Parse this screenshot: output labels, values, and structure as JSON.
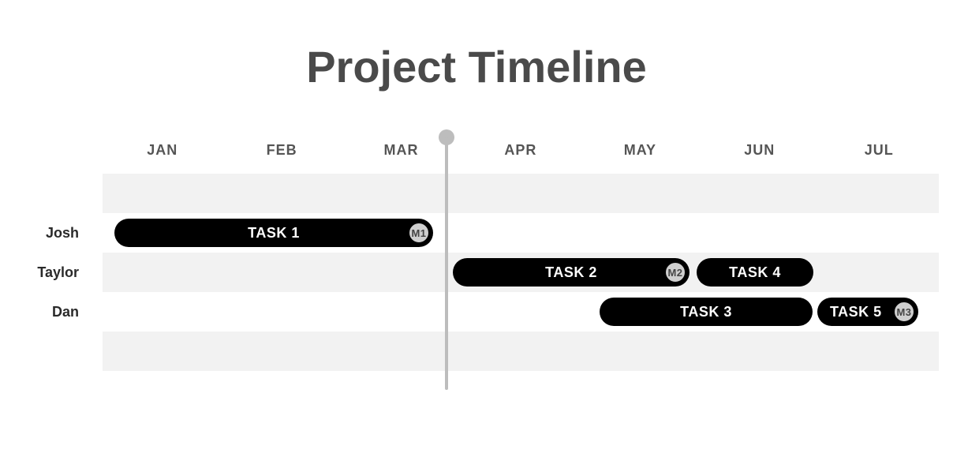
{
  "title": "Project Timeline",
  "months": [
    "JAN",
    "FEB",
    "MAR",
    "APR",
    "MAY",
    "JUN",
    "JUL"
  ],
  "people": [
    "Josh",
    "Taylor",
    "Dan"
  ],
  "tasks": {
    "t1": {
      "label": "TASK 1"
    },
    "t2": {
      "label": "TASK 2"
    },
    "t3": {
      "label": "TASK 3"
    },
    "t4": {
      "label": "TASK 4"
    },
    "t5": {
      "label": "TASK 5"
    }
  },
  "milestones": {
    "m1": "M1",
    "m2": "M2",
    "m3": "M3"
  },
  "chart_data": {
    "type": "gantt",
    "title": "Project Timeline",
    "x_categories": [
      "JAN",
      "FEB",
      "MAR",
      "APR",
      "MAY",
      "JUN",
      "JUL"
    ],
    "today_marker_after": "MAR",
    "rows": [
      {
        "label": "Josh",
        "tasks": [
          {
            "name": "TASK 1",
            "start": "JAN",
            "end": "MAR",
            "milestone": "M1"
          }
        ]
      },
      {
        "label": "Taylor",
        "tasks": [
          {
            "name": "TASK 2",
            "start": "APR",
            "end": "MAY",
            "milestone": "M2"
          },
          {
            "name": "TASK 4",
            "start": "JUN",
            "end": "JUN"
          }
        ]
      },
      {
        "label": "Dan",
        "tasks": [
          {
            "name": "TASK 3",
            "start": "MAY",
            "end": "JUN"
          },
          {
            "name": "TASK 5",
            "start": "JUL",
            "end": "JUL",
            "milestone": "M3"
          }
        ]
      }
    ]
  }
}
